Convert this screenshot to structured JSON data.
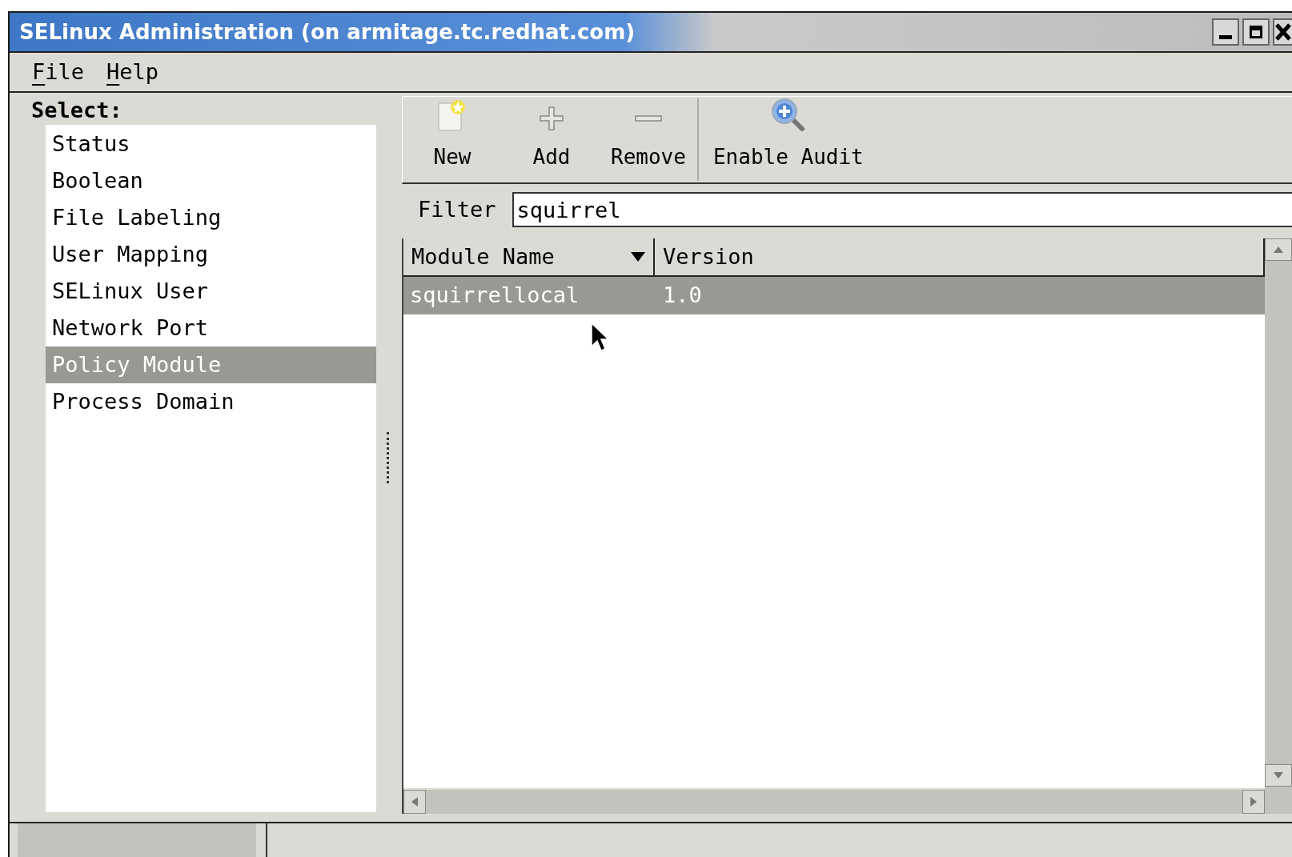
{
  "window": {
    "title": "SELinux Administration (on armitage.tc.redhat.com)"
  },
  "menu": [
    {
      "label": "File",
      "first_letter_underlined": true
    },
    {
      "label": "Help",
      "first_letter_underlined": true
    }
  ],
  "sidebar": {
    "heading": "Select:",
    "items": [
      {
        "label": "Status",
        "selected": false
      },
      {
        "label": "Boolean",
        "selected": false
      },
      {
        "label": "File Labeling",
        "selected": false
      },
      {
        "label": "User Mapping",
        "selected": false
      },
      {
        "label": "SELinux User",
        "selected": false
      },
      {
        "label": "Network Port",
        "selected": false
      },
      {
        "label": "Policy Module",
        "selected": true
      },
      {
        "label": "Process Domain",
        "selected": false
      }
    ]
  },
  "toolbar": [
    {
      "kind": "new",
      "label": "New"
    },
    {
      "kind": "add",
      "label": "Add"
    },
    {
      "kind": "remove",
      "label": "Remove"
    },
    {
      "kind": "separator"
    },
    {
      "kind": "audit",
      "label": "Enable Audit"
    }
  ],
  "filter": {
    "label": "Filter",
    "value": "squirrel"
  },
  "table": {
    "columns": [
      {
        "label": "Module Name",
        "sorted": true
      },
      {
        "label": "Version",
        "sorted": false
      }
    ],
    "rows": [
      {
        "cells": [
          "squirrellocal",
          "1.0"
        ],
        "selected": true
      }
    ]
  }
}
